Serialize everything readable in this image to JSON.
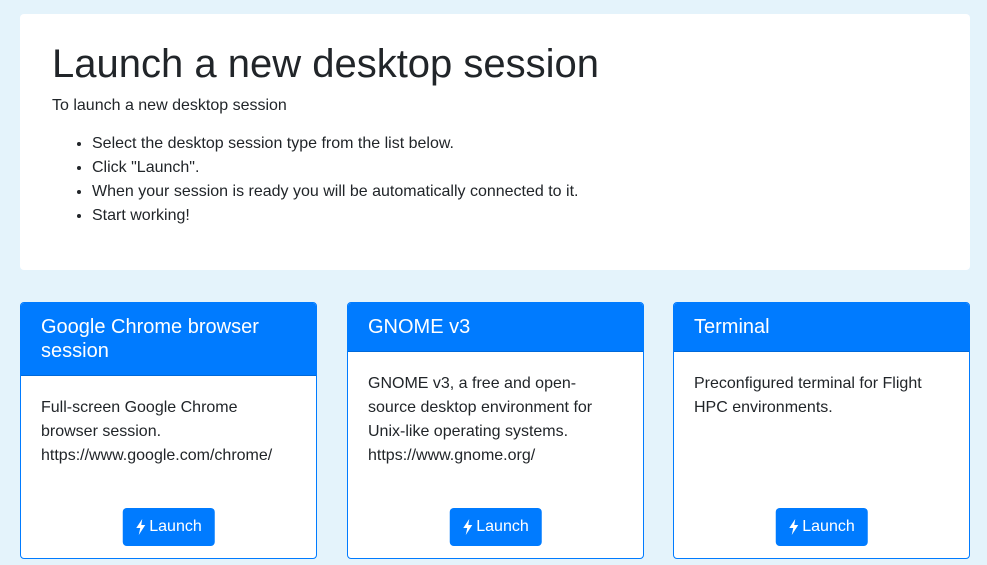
{
  "intro": {
    "title": "Launch a new desktop session",
    "subtitle": "To launch a new desktop session",
    "steps": [
      "Select the desktop session type from the list below.",
      "Click \"Launch\".",
      "When your session is ready you will be automatically connected to it.",
      "Start working!"
    ]
  },
  "sessions": [
    {
      "title": "Google Chrome browser session",
      "description": "Full-screen Google Chrome browser session. https://www.google.com/chrome/",
      "button_label": "Launch",
      "icon": "bolt-icon"
    },
    {
      "title": "GNOME v3",
      "description": "GNOME v3, a free and open-source desktop environment for Unix-like operating systems. https://www.gnome.org/",
      "button_label": "Launch",
      "icon": "bolt-icon"
    },
    {
      "title": "Terminal",
      "description": "Preconfigured terminal for Flight HPC environments.",
      "button_label": "Launch",
      "icon": "bolt-icon"
    }
  ],
  "colors": {
    "page_background": "#e4f3fb",
    "primary": "#007bff"
  }
}
